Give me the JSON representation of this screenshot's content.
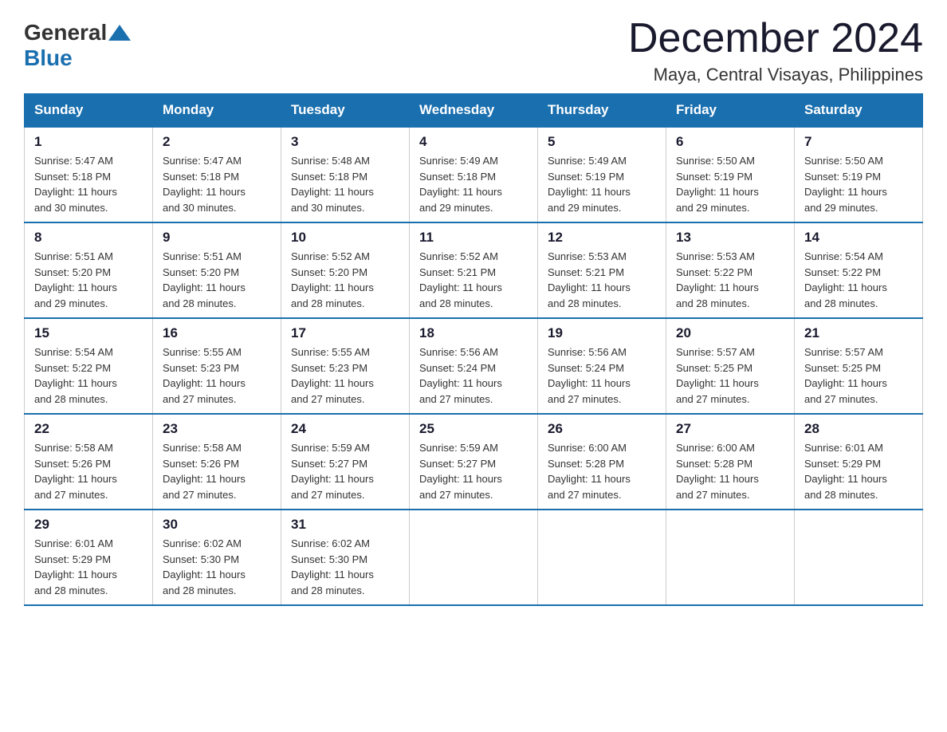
{
  "logo": {
    "general": "General",
    "blue": "Blue"
  },
  "header": {
    "month": "December 2024",
    "location": "Maya, Central Visayas, Philippines"
  },
  "weekdays": [
    "Sunday",
    "Monday",
    "Tuesday",
    "Wednesday",
    "Thursday",
    "Friday",
    "Saturday"
  ],
  "weeks": [
    [
      {
        "day": "1",
        "sunrise": "5:47 AM",
        "sunset": "5:18 PM",
        "daylight": "11 hours and 30 minutes."
      },
      {
        "day": "2",
        "sunrise": "5:47 AM",
        "sunset": "5:18 PM",
        "daylight": "11 hours and 30 minutes."
      },
      {
        "day": "3",
        "sunrise": "5:48 AM",
        "sunset": "5:18 PM",
        "daylight": "11 hours and 30 minutes."
      },
      {
        "day": "4",
        "sunrise": "5:49 AM",
        "sunset": "5:18 PM",
        "daylight": "11 hours and 29 minutes."
      },
      {
        "day": "5",
        "sunrise": "5:49 AM",
        "sunset": "5:19 PM",
        "daylight": "11 hours and 29 minutes."
      },
      {
        "day": "6",
        "sunrise": "5:50 AM",
        "sunset": "5:19 PM",
        "daylight": "11 hours and 29 minutes."
      },
      {
        "day": "7",
        "sunrise": "5:50 AM",
        "sunset": "5:19 PM",
        "daylight": "11 hours and 29 minutes."
      }
    ],
    [
      {
        "day": "8",
        "sunrise": "5:51 AM",
        "sunset": "5:20 PM",
        "daylight": "11 hours and 29 minutes."
      },
      {
        "day": "9",
        "sunrise": "5:51 AM",
        "sunset": "5:20 PM",
        "daylight": "11 hours and 28 minutes."
      },
      {
        "day": "10",
        "sunrise": "5:52 AM",
        "sunset": "5:20 PM",
        "daylight": "11 hours and 28 minutes."
      },
      {
        "day": "11",
        "sunrise": "5:52 AM",
        "sunset": "5:21 PM",
        "daylight": "11 hours and 28 minutes."
      },
      {
        "day": "12",
        "sunrise": "5:53 AM",
        "sunset": "5:21 PM",
        "daylight": "11 hours and 28 minutes."
      },
      {
        "day": "13",
        "sunrise": "5:53 AM",
        "sunset": "5:22 PM",
        "daylight": "11 hours and 28 minutes."
      },
      {
        "day": "14",
        "sunrise": "5:54 AM",
        "sunset": "5:22 PM",
        "daylight": "11 hours and 28 minutes."
      }
    ],
    [
      {
        "day": "15",
        "sunrise": "5:54 AM",
        "sunset": "5:22 PM",
        "daylight": "11 hours and 28 minutes."
      },
      {
        "day": "16",
        "sunrise": "5:55 AM",
        "sunset": "5:23 PM",
        "daylight": "11 hours and 27 minutes."
      },
      {
        "day": "17",
        "sunrise": "5:55 AM",
        "sunset": "5:23 PM",
        "daylight": "11 hours and 27 minutes."
      },
      {
        "day": "18",
        "sunrise": "5:56 AM",
        "sunset": "5:24 PM",
        "daylight": "11 hours and 27 minutes."
      },
      {
        "day": "19",
        "sunrise": "5:56 AM",
        "sunset": "5:24 PM",
        "daylight": "11 hours and 27 minutes."
      },
      {
        "day": "20",
        "sunrise": "5:57 AM",
        "sunset": "5:25 PM",
        "daylight": "11 hours and 27 minutes."
      },
      {
        "day": "21",
        "sunrise": "5:57 AM",
        "sunset": "5:25 PM",
        "daylight": "11 hours and 27 minutes."
      }
    ],
    [
      {
        "day": "22",
        "sunrise": "5:58 AM",
        "sunset": "5:26 PM",
        "daylight": "11 hours and 27 minutes."
      },
      {
        "day": "23",
        "sunrise": "5:58 AM",
        "sunset": "5:26 PM",
        "daylight": "11 hours and 27 minutes."
      },
      {
        "day": "24",
        "sunrise": "5:59 AM",
        "sunset": "5:27 PM",
        "daylight": "11 hours and 27 minutes."
      },
      {
        "day": "25",
        "sunrise": "5:59 AM",
        "sunset": "5:27 PM",
        "daylight": "11 hours and 27 minutes."
      },
      {
        "day": "26",
        "sunrise": "6:00 AM",
        "sunset": "5:28 PM",
        "daylight": "11 hours and 27 minutes."
      },
      {
        "day": "27",
        "sunrise": "6:00 AM",
        "sunset": "5:28 PM",
        "daylight": "11 hours and 27 minutes."
      },
      {
        "day": "28",
        "sunrise": "6:01 AM",
        "sunset": "5:29 PM",
        "daylight": "11 hours and 28 minutes."
      }
    ],
    [
      {
        "day": "29",
        "sunrise": "6:01 AM",
        "sunset": "5:29 PM",
        "daylight": "11 hours and 28 minutes."
      },
      {
        "day": "30",
        "sunrise": "6:02 AM",
        "sunset": "5:30 PM",
        "daylight": "11 hours and 28 minutes."
      },
      {
        "day": "31",
        "sunrise": "6:02 AM",
        "sunset": "5:30 PM",
        "daylight": "11 hours and 28 minutes."
      },
      null,
      null,
      null,
      null
    ]
  ],
  "labels": {
    "sunrise": "Sunrise: ",
    "sunset": "Sunset: ",
    "daylight": "Daylight: "
  }
}
